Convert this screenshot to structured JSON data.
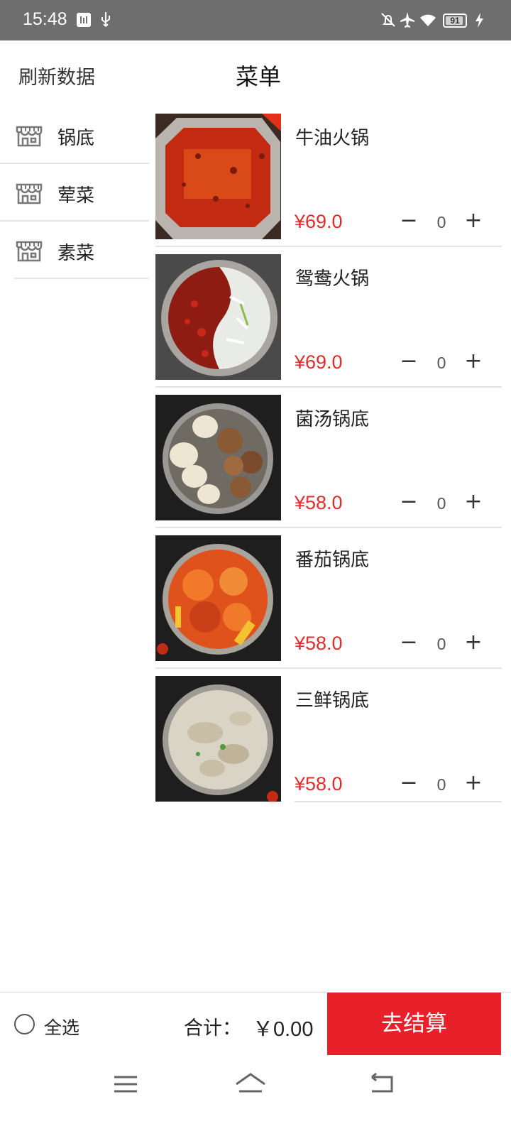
{
  "status_bar": {
    "time": "15:48",
    "battery": "91",
    "icons": [
      "usb-debug-icon",
      "usb-icon",
      "mute-icon",
      "airplane-icon",
      "wifi-icon",
      "battery-icon",
      "charging-icon"
    ]
  },
  "header": {
    "refresh_label": "刷新数据",
    "title": "菜单"
  },
  "sidebar": {
    "items": [
      {
        "label": "锅底",
        "icon": "shop-icon"
      },
      {
        "label": "荤菜",
        "icon": "shop-icon"
      },
      {
        "label": "素菜",
        "icon": "shop-icon"
      }
    ]
  },
  "products": [
    {
      "name": "牛油火锅",
      "price": "¥69.0",
      "qty": "0",
      "image": "butter-hotpot-image"
    },
    {
      "name": "鸳鸯火锅",
      "price": "¥69.0",
      "qty": "0",
      "image": "yuanyang-hotpot-image"
    },
    {
      "name": "菌汤锅底",
      "price": "¥58.0",
      "qty": "0",
      "image": "mushroom-soup-image"
    },
    {
      "name": "番茄锅底",
      "price": "¥58.0",
      "qty": "0",
      "image": "tomato-soup-image"
    },
    {
      "name": "三鲜锅底",
      "price": "¥58.0",
      "qty": "0",
      "image": "three-delicacy-soup-image"
    }
  ],
  "controls": {
    "minus": "−",
    "plus": "+"
  },
  "bottom_bar": {
    "select_all_label": "全选",
    "total_label": "合计：",
    "total_amount": "￥0.00",
    "checkout_label": "去结算"
  },
  "colors": {
    "accent": "#e8202a",
    "price": "#e32b2b",
    "status_bar": "#6e6e6e"
  }
}
